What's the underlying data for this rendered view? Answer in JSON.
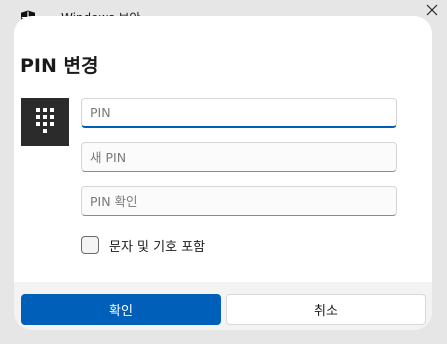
{
  "window": {
    "title": "Windows 보안",
    "icon": "shield-icon",
    "close_icon": "close-icon"
  },
  "dialog": {
    "heading": "PIN 변경",
    "tile_icon": "keypad-icon",
    "fields": [
      {
        "placeholder": "PIN",
        "value": "",
        "focused": true
      },
      {
        "placeholder": "새 PIN",
        "value": ""
      },
      {
        "placeholder": "PIN 확인",
        "value": ""
      }
    ],
    "checkbox": {
      "label": "문자 및 기호 포함",
      "checked": false
    }
  },
  "footer": {
    "ok_label": "확인",
    "cancel_label": "취소"
  },
  "colors": {
    "accent": "#005fb8",
    "tile": "#2b2b2b"
  }
}
